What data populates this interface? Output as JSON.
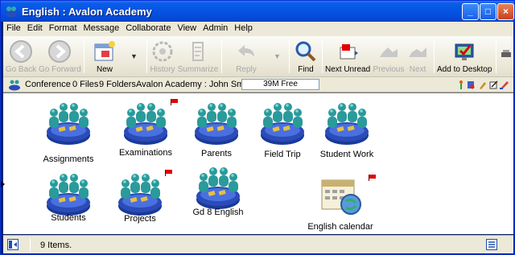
{
  "window": {
    "title": "English : Avalon Academy",
    "controls": [
      "_",
      "□",
      "×"
    ]
  },
  "menu": [
    "File",
    "Edit",
    "Format",
    "Message",
    "Collaborate",
    "View",
    "Admin",
    "Help"
  ],
  "toolbar": {
    "go_back": "Go Back",
    "go_forward": "Go Forward",
    "new": "New",
    "history": "History",
    "summarize": "Summarize",
    "reply": "Reply",
    "find": "Find",
    "next_unread": "Next Unread",
    "previous": "Previous",
    "next": "Next",
    "add_to_desktop": "Add to Desktop"
  },
  "pathbar": {
    "location": "Conference",
    "files": "0 Files",
    "folders": "9 Folders",
    "context": "Avalon Academy : John Smith",
    "free_space": "39M Free"
  },
  "items": [
    {
      "label": "Assignments",
      "type": "conference",
      "flag": false
    },
    {
      "label": "Examinations",
      "type": "conference",
      "flag": true
    },
    {
      "label": "Parents",
      "type": "conference",
      "flag": false
    },
    {
      "label": "Field Trip",
      "type": "conference",
      "flag": false
    },
    {
      "label": "Student Work",
      "type": "conference",
      "flag": false
    },
    {
      "label": "Students",
      "type": "conference",
      "flag": false
    },
    {
      "label": "Projects",
      "type": "conference",
      "flag": true
    },
    {
      "label": "Gd 8 English",
      "type": "conference",
      "flag": false
    },
    {
      "label": "English calendar",
      "type": "calendar",
      "flag": true
    }
  ],
  "status": {
    "count": "9 Items."
  },
  "colors": {
    "titlebar": "#0554e3",
    "chrome": "#ece9d8",
    "conference_teal": "#2a9a9a",
    "table_blue": "#2b4cb8",
    "flag_red": "#e00000"
  }
}
